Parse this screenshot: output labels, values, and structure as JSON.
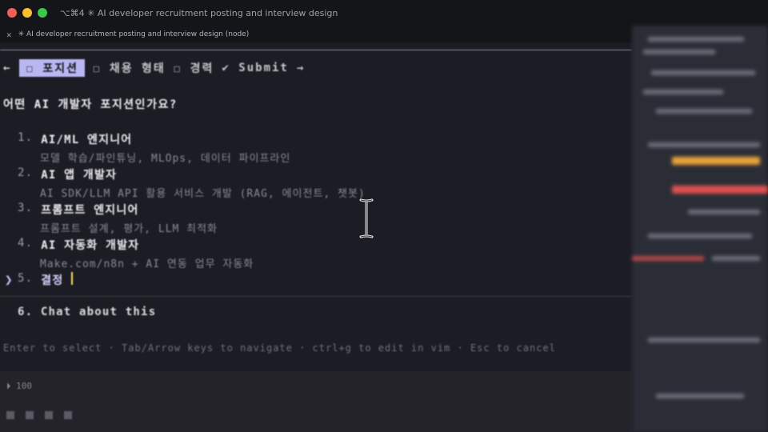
{
  "window": {
    "shortcut": "⌥⌘4",
    "title": "✳ AI developer recruitment posting and interview design",
    "tab_title": "✳ AI developer recruitment posting and interview design (node)"
  },
  "nav": {
    "back": "←",
    "items": [
      {
        "check": "☐",
        "label": "포지션",
        "active": true
      },
      {
        "check": "☐",
        "label": "채용 형태",
        "active": false
      },
      {
        "check": "☐",
        "label": "경력",
        "active": false
      }
    ],
    "submit": "✔ Submit",
    "forward": "→"
  },
  "question": "어떤 AI 개발자 포지션인가요?",
  "options": [
    {
      "num": "1.",
      "title": "AI/ML 엔지니어",
      "desc": "모델 학습/파인튜닝, MLOps, 데이터 파이프라인"
    },
    {
      "num": "2.",
      "title": "AI 앱 개발자",
      "desc": "AI SDK/LLM API 활용 서비스 개발 (RAG, 에이전트, 챗봇)"
    },
    {
      "num": "3.",
      "title": "프롬프트 엔지니어",
      "desc": "프롬프트 설계, 평가, LLM 최적화"
    },
    {
      "num": "4.",
      "title": "AI 자동화 개발자",
      "desc": "Make.com/n8n + AI 연동 업무 자동화"
    },
    {
      "num": "5.",
      "title": "결정",
      "desc": ""
    }
  ],
  "pointer": "❯",
  "chat": "6. Chat about this",
  "hint": "Enter to select · Tab/Arrow keys to navigate · ctrl+g to edit in vim · Esc to cancel",
  "status": "⏵ 100",
  "colors": {
    "active_tab_bg": "#b9b7f2",
    "cursor": "#f0e35a",
    "side_orange": "#e8a43a",
    "side_red": "#e05050"
  }
}
